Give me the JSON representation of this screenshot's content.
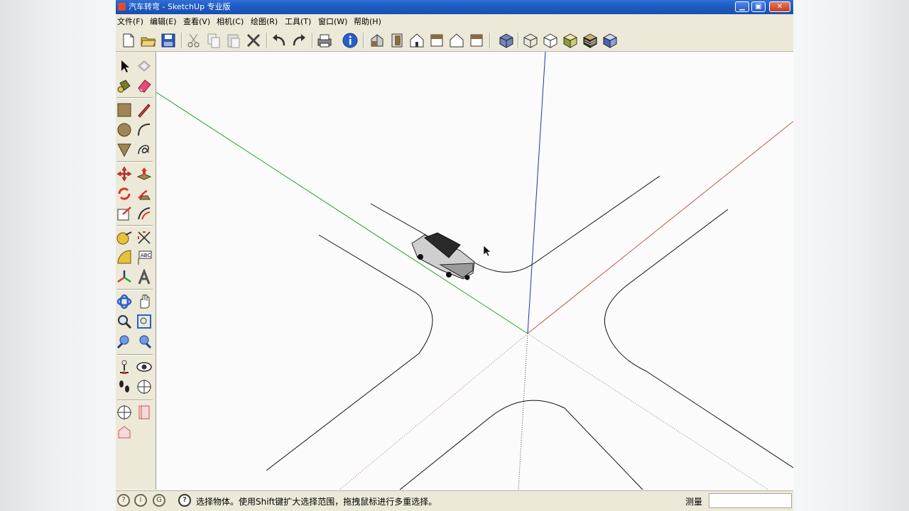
{
  "window": {
    "title": "汽车转弯 - SketchUp 专业版",
    "controls": {
      "minimize": "▁",
      "maximize": "▣",
      "close": "✕"
    }
  },
  "menu": {
    "items": [
      "文件(F)",
      "编辑(E)",
      "查看(V)",
      "相机(C)",
      "绘图(R)",
      "工具(T)",
      "窗口(W)",
      "帮助(H)"
    ]
  },
  "toolbar": {
    "icons": [
      "new-icon",
      "open-icon",
      "save-icon",
      "cut-icon",
      "copy-icon",
      "paste-icon",
      "delete-icon",
      "undo-icon",
      "redo-icon",
      "print-icon",
      "model-info-icon",
      "iso-view-icon",
      "top-view-icon",
      "front-view-icon",
      "right-view-icon",
      "back-view-icon",
      "left-view-icon",
      "xray-icon",
      "wireframe-icon",
      "hidden-line-icon",
      "shaded-icon",
      "textured-icon",
      "monochrome-icon"
    ]
  },
  "statusbar": {
    "hint": "选择物体。使用Shift键扩大选择范围，拖拽鼠标进行多重选择。",
    "measure_label": "测量",
    "measure_value": ""
  },
  "colors": {
    "title_blue": "#1f5bc4",
    "axis_green": "#2aa02a",
    "axis_blue": "#2233aa",
    "axis_red": "#c0554a",
    "chrome": "#ece9d8"
  }
}
